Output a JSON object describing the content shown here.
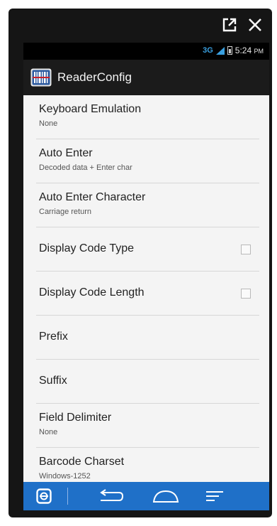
{
  "status_bar": {
    "network": "3G",
    "time": "5:24",
    "ampm": "PM"
  },
  "app_bar": {
    "title": "ReaderConfig",
    "icon": "barcode-reader-icon"
  },
  "window_controls": {
    "icons": [
      "popout-icon",
      "close-icon"
    ]
  },
  "settings": [
    {
      "title": "Keyboard Emulation",
      "summary": "None"
    },
    {
      "title": "Auto Enter",
      "summary": "Decoded data + Enter char"
    },
    {
      "title": "Auto Enter Character",
      "summary": "Carriage return"
    },
    {
      "title": "Display Code Type",
      "checked": false
    },
    {
      "title": "Display Code Length",
      "checked": false
    },
    {
      "title": "Prefix"
    },
    {
      "title": "Suffix"
    },
    {
      "title": "Field Delimiter",
      "summary": "None"
    },
    {
      "title": "Barcode Charset",
      "summary": "Windows-1252"
    }
  ],
  "nav_bar": {
    "icons": [
      "scanner-app-icon",
      "back-icon",
      "home-icon",
      "recents-icon"
    ]
  },
  "colors": {
    "nav_bar": "#1f70c8",
    "app_bar": "#1b1b1b",
    "list_bg": "#f4f4f4",
    "icon_red": "#c8202a",
    "network_blue": "#3aa0e0"
  }
}
